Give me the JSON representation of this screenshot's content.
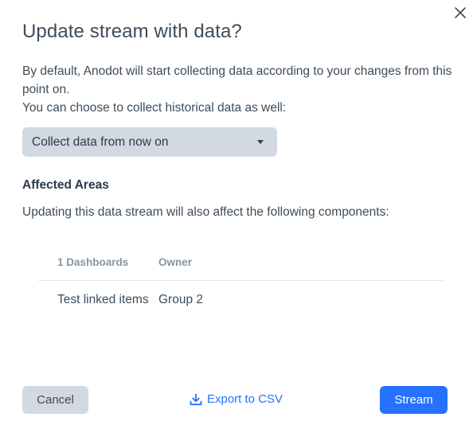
{
  "dialog": {
    "title": "Update stream with data?",
    "close_icon": "close-icon"
  },
  "description": {
    "line1": "By default, Anodot will start collecting data according to your changes from this point on.",
    "line2": "You can choose to collect historical data as well:"
  },
  "collect_select": {
    "value": "Collect data from now on",
    "icon": "caret-down-icon"
  },
  "affected": {
    "title": "Affected Areas",
    "description": "Updating this data stream will also affect the following components:",
    "columns": [
      "1 Dashboards",
      "Owner"
    ],
    "rows": [
      [
        "Test linked items",
        "Group 2"
      ]
    ]
  },
  "footer": {
    "cancel_label": "Cancel",
    "export_label": "Export to CSV",
    "export_icon": "download-icon",
    "stream_label": "Stream"
  },
  "colors": {
    "primary": "#2671ff",
    "text": "#3d4c59",
    "button_gray": "#d3d9e0"
  }
}
